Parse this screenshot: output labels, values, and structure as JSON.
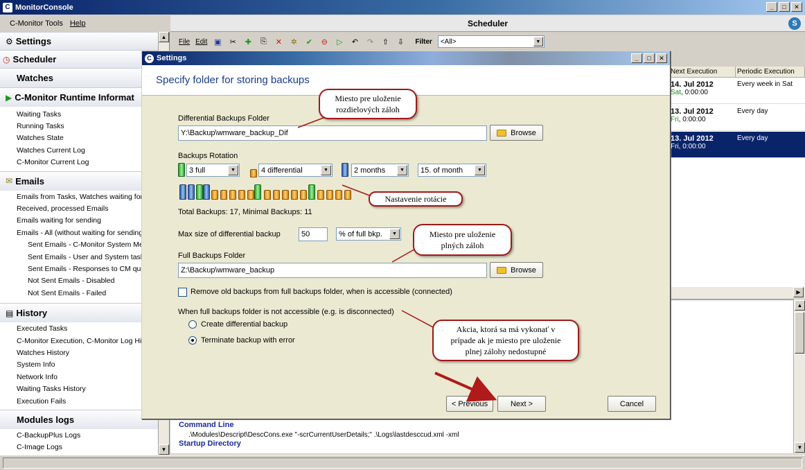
{
  "window": {
    "title": "MonitorConsole",
    "icon": "C"
  },
  "menu": [
    "C-Monitor Tools",
    "Help"
  ],
  "scheduler": {
    "title": "Scheduler"
  },
  "toolbar": {
    "file": "File",
    "edit": "Edit",
    "filter_label": "Filter",
    "filter_value": "<All>"
  },
  "sidebar": {
    "settings": "Settings",
    "scheduler": "Scheduler",
    "watches": "Watches",
    "runtime": "C-Monitor Runtime Informat",
    "runtime_items": [
      "Waiting Tasks",
      "Running Tasks",
      "Watches State",
      "Watches Current Log",
      "C-Monitor Current Log"
    ],
    "emails": "Emails",
    "email_items": [
      "Emails from Tasks, Watches waiting for",
      "Received, processed Emails",
      "Emails waiting for sending",
      "Emails - All (without waiting for sending)"
    ],
    "email_sub_items": [
      "Sent Emails - C-Monitor System Mes",
      "Sent Emails - User and System task",
      "Sent Emails - Responses to CM que",
      "Not Sent Emails - Disabled",
      "Not Sent Emails - Failed"
    ],
    "history": "History",
    "history_items": [
      "Executed Tasks",
      "C-Monitor Execution, C-Monitor Log His",
      "Watches History",
      "System Info",
      "Network Info",
      "Waiting Tasks History",
      "Execution Fails"
    ],
    "modules": "Modules logs",
    "module_items": [
      "C-BackupPlus Logs",
      "C-Image Logs"
    ]
  },
  "grid": {
    "columns": [
      "Next Execution",
      "Periodic Execution"
    ],
    "rows": [
      {
        "date": "14. Jul 2012",
        "day": "Sat",
        "time": ", 0:00:00",
        "period": "Every week in Sat",
        "selected": false
      },
      {
        "date": "13. Jul 2012",
        "day": "Fri",
        "time": ", 0:00:00",
        "period": "Every day",
        "selected": false
      },
      {
        "date": "13. Jul 2012",
        "day": "Fri",
        "time": ", 0:00:00",
        "period": "Every day",
        "selected": true
      }
    ]
  },
  "detail": {
    "command_line_label": "Command Line",
    "command_line_value": ".\\Modules\\Descript\\DescCons.exe \"-scrCurrentUserDetails;\" .\\Logs\\lastdesccud.xml -xml",
    "startup_dir_label": "Startup Directory"
  },
  "dialog": {
    "title": "Settings",
    "header": "Specify folder for storing backups",
    "diff_label": "Differential Backups Folder",
    "diff_path": "Y:\\Backup\\wmware_backup_Dif",
    "browse": "Browse",
    "rotation_label": "Backups Rotation",
    "rot_full": "3 full",
    "rot_diff": "4 differential",
    "rot_period": "2 months",
    "rot_day": "15. of month",
    "totals": "Total Backups: 17, Minimal Backups: 11",
    "maxsize_label": "Max size of differential backup",
    "maxsize_value": "50",
    "maxsize_unit": "% of full bkp.",
    "full_label": "Full Backups Folder",
    "full_path": "Z:\\Backup\\wmware_backup",
    "remove_old": "Remove old backups from full backups folder, when is accessible (connected)",
    "not_accessible": "When full backups folder is not accessible (e.g. is disconnected)",
    "opt_create": "Create differential backup",
    "opt_terminate": "Terminate backup with error",
    "prev": "< Previous",
    "next": "Next >",
    "cancel": "Cancel"
  },
  "callouts": {
    "diff": "Miesto pre uloženie\nrozdielových záloh",
    "rotation": "Nastavenie rotácie",
    "full": "Miesto pre uloženie\nplných záloh",
    "action": "Akcia, ktorá sa má vykonať v\nprípade ak je miesto pre uloženie\nplnej zálohy nedostupné"
  },
  "colors": {
    "accent": "#0a246a",
    "callout_border": "#a01818",
    "arrow": "#b01a1a"
  }
}
